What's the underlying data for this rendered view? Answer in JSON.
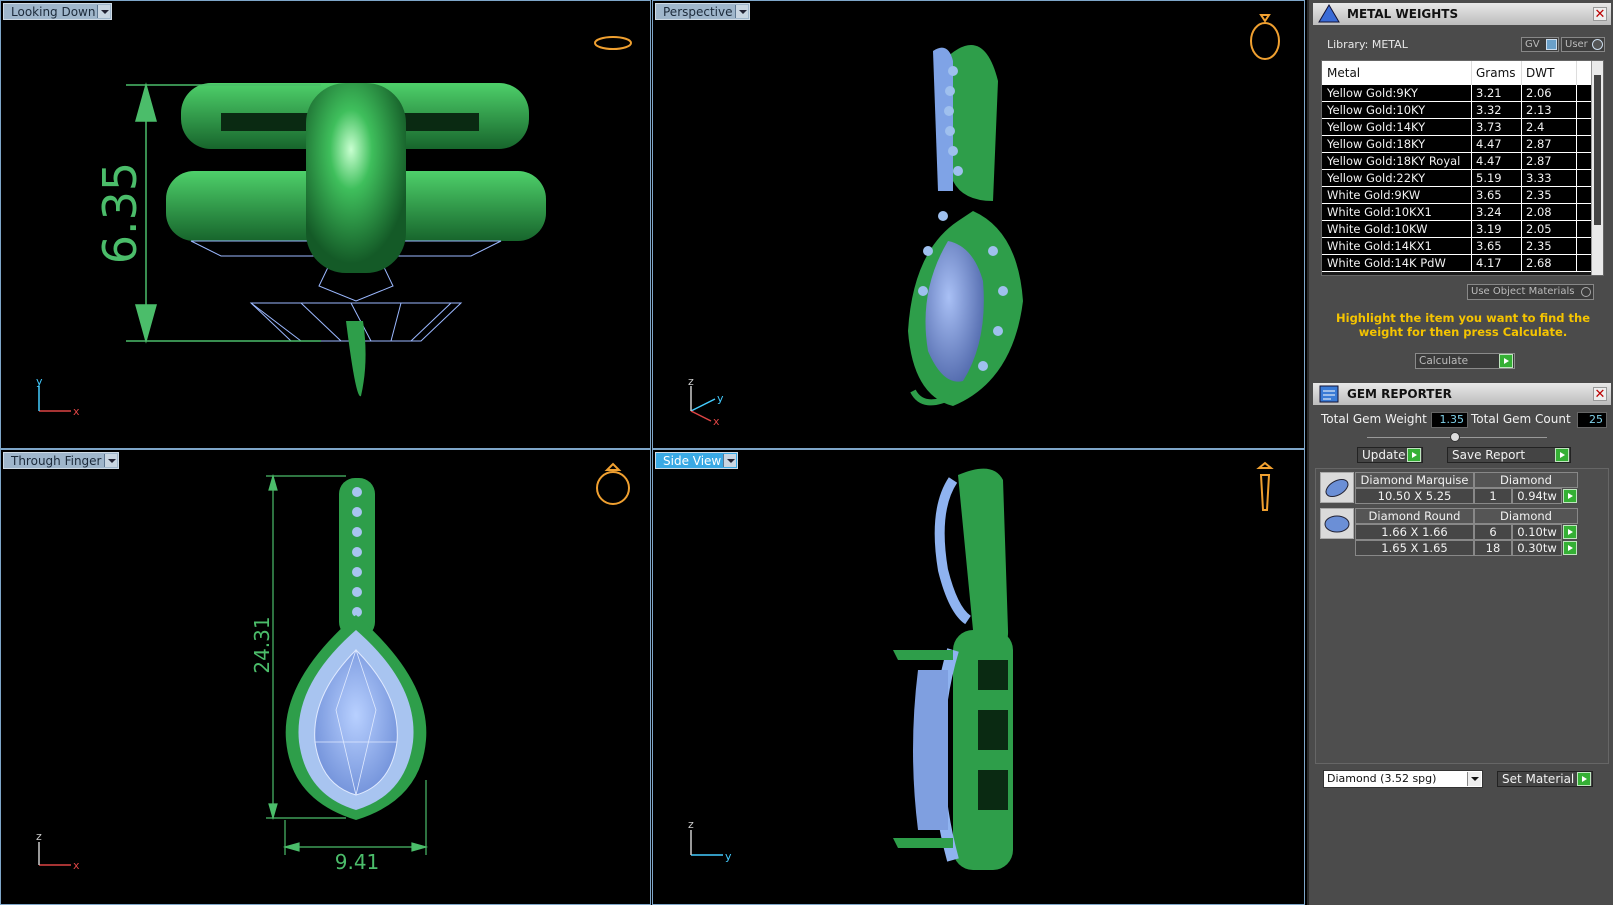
{
  "viewports": {
    "top": {
      "label": "Looking Down",
      "dimension": "6.35",
      "axis_v": "y",
      "axis_h": "x"
    },
    "perspective": {
      "label": "Perspective",
      "axis_v": "z",
      "axis_h": "x",
      "axis_d": "y"
    },
    "front": {
      "label": "Through Finger",
      "dimension_v": "24.31",
      "dimension_h": "9.41",
      "axis_v": "z",
      "axis_h": "x"
    },
    "side": {
      "label": "Side View",
      "axis_v": "z",
      "axis_h": "y",
      "active": true
    }
  },
  "metal_weights": {
    "title": "METAL WEIGHTS",
    "library_label": "Library: METAL",
    "toggle_gv": "GV",
    "toggle_user": "User",
    "columns": [
      "Metal",
      "Grams",
      "DWT"
    ],
    "rows": [
      [
        "Yellow Gold:9KY",
        "3.21",
        "2.06"
      ],
      [
        "Yellow Gold:10KY",
        "3.32",
        "2.13"
      ],
      [
        "Yellow Gold:14KY",
        "3.73",
        "2.4"
      ],
      [
        "Yellow Gold:18KY",
        "4.47",
        "2.87"
      ],
      [
        "Yellow Gold:18KY Royal",
        "4.47",
        "2.87"
      ],
      [
        "Yellow Gold:22KY",
        "5.19",
        "3.33"
      ],
      [
        "White Gold:9KW",
        "3.65",
        "2.35"
      ],
      [
        "White Gold:10KX1",
        "3.24",
        "2.08"
      ],
      [
        "White Gold:10KW",
        "3.19",
        "2.05"
      ],
      [
        "White Gold:14KX1",
        "3.65",
        "2.35"
      ],
      [
        "White Gold:14K PdW",
        "4.17",
        "2.68"
      ]
    ],
    "use_object_materials": "Use Object Materials",
    "hint": "Highlight the item you want to find the weight for then press Calculate.",
    "calculate_label": "Calculate"
  },
  "gem_reporter": {
    "title": "GEM REPORTER",
    "total_weight_label": "Total Gem Weight",
    "total_weight_value": "1.35",
    "total_count_label": "Total Gem Count",
    "total_count_value": "25",
    "update_label": "Update",
    "save_report_label": "Save Report",
    "groups": [
      {
        "shape": "Diamond Marquise",
        "material": "Diamond",
        "rows": [
          [
            "10.50 X 5.25",
            "1",
            "0.94tw"
          ]
        ]
      },
      {
        "shape": "Diamond Round",
        "material": "Diamond",
        "rows": [
          [
            "1.66 X 1.66",
            "6",
            "0.10tw"
          ],
          [
            "1.65 X 1.65",
            "18",
            "0.30tw"
          ]
        ]
      }
    ],
    "material_select": "Diamond    (3.52 spg)",
    "set_material_label": "Set Material"
  },
  "colors": {
    "metal_green": "#2e9e4a",
    "gem_blue": "#8fb3f0",
    "dimension_green": "#4bbd6a",
    "hint_yellow": "#f5c400"
  }
}
